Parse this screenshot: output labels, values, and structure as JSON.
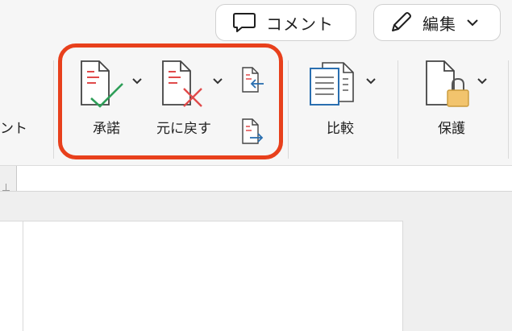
{
  "header": {
    "comment_label": "コメント",
    "edit_label": "編集"
  },
  "ribbon": {
    "partial_label": "ント",
    "accept_label": "承諾",
    "reject_label": "元に戻す",
    "compare_label": "比較",
    "protect_label": "保護"
  },
  "colors": {
    "highlight": "#e8401c",
    "accept_check": "#2e9e58",
    "reject_x": "#e04a4a",
    "compare_blue": "#2a6fb0",
    "lock_gold": "#f2c46d"
  }
}
